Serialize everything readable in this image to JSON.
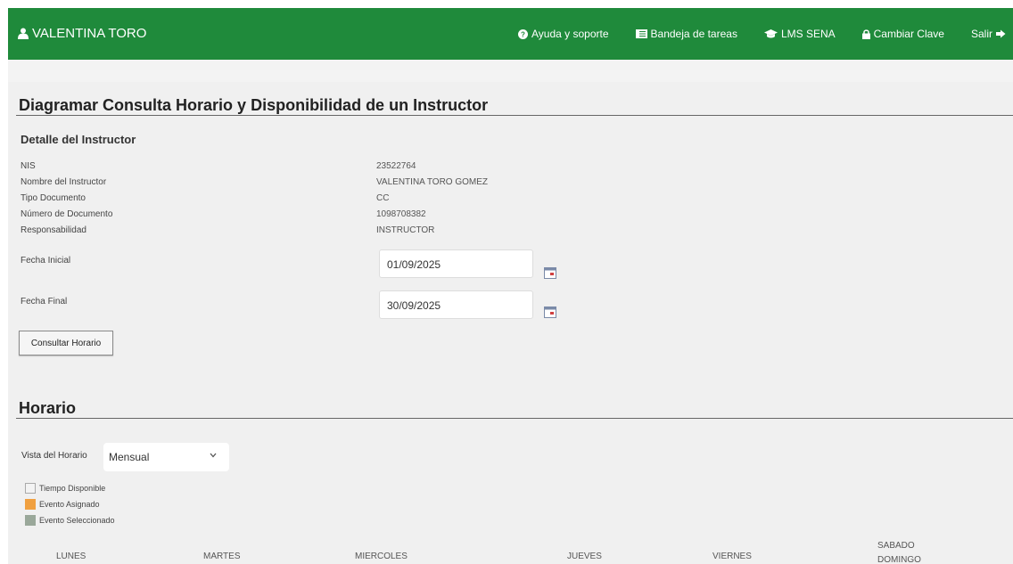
{
  "navbar": {
    "user": "VALENTINA TORO",
    "links": [
      {
        "label": "Ayuda y soporte",
        "icon": "question-circle-icon"
      },
      {
        "label": "Bandeja de tareas",
        "icon": "list-icon"
      },
      {
        "label": "LMS SENA",
        "icon": "graduation-cap-icon"
      },
      {
        "label": "Cambiar Clave",
        "icon": "lock-icon"
      },
      {
        "label": "Salir",
        "icon": "sign-out-icon"
      }
    ]
  },
  "page": {
    "title": "Diagramar Consulta Horario y Disponibilidad de un Instructor",
    "detail_title": "Detalle del Instructor",
    "details": [
      {
        "label": "NIS",
        "value": "23522764"
      },
      {
        "label": "Nombre del Instructor",
        "value": "VALENTINA TORO GOMEZ"
      },
      {
        "label": "Tipo Documento",
        "value": "CC"
      },
      {
        "label": "Número de Documento",
        "value": "1098708382"
      },
      {
        "label": "Responsabilidad",
        "value": "INSTRUCTOR"
      }
    ],
    "fecha_inicial_label": "Fecha Inicial",
    "fecha_inicial_value": "01/09/2025",
    "fecha_final_label": "Fecha Final",
    "fecha_final_value": "30/09/2025",
    "consultar_button": "Consultar Horario"
  },
  "horario": {
    "title": "Horario",
    "vista_label": "Vista del Horario",
    "vista_value": "Mensual",
    "legend": [
      {
        "label": "Tiempo Disponible",
        "color": "#f3f3f3"
      },
      {
        "label": "Evento Asignado",
        "color": "#f0a040"
      },
      {
        "label": "Evento Seleccionado",
        "color": "#9aa89a"
      }
    ],
    "days": [
      "LUNES",
      "MARTES",
      "MIERCOLES",
      "JUEVES",
      "VIERNES"
    ],
    "weekend": [
      "SABADO",
      "DOMINGO"
    ]
  },
  "colors": {
    "navbar": "#1f8a3b",
    "background": "#f0f0f0"
  }
}
